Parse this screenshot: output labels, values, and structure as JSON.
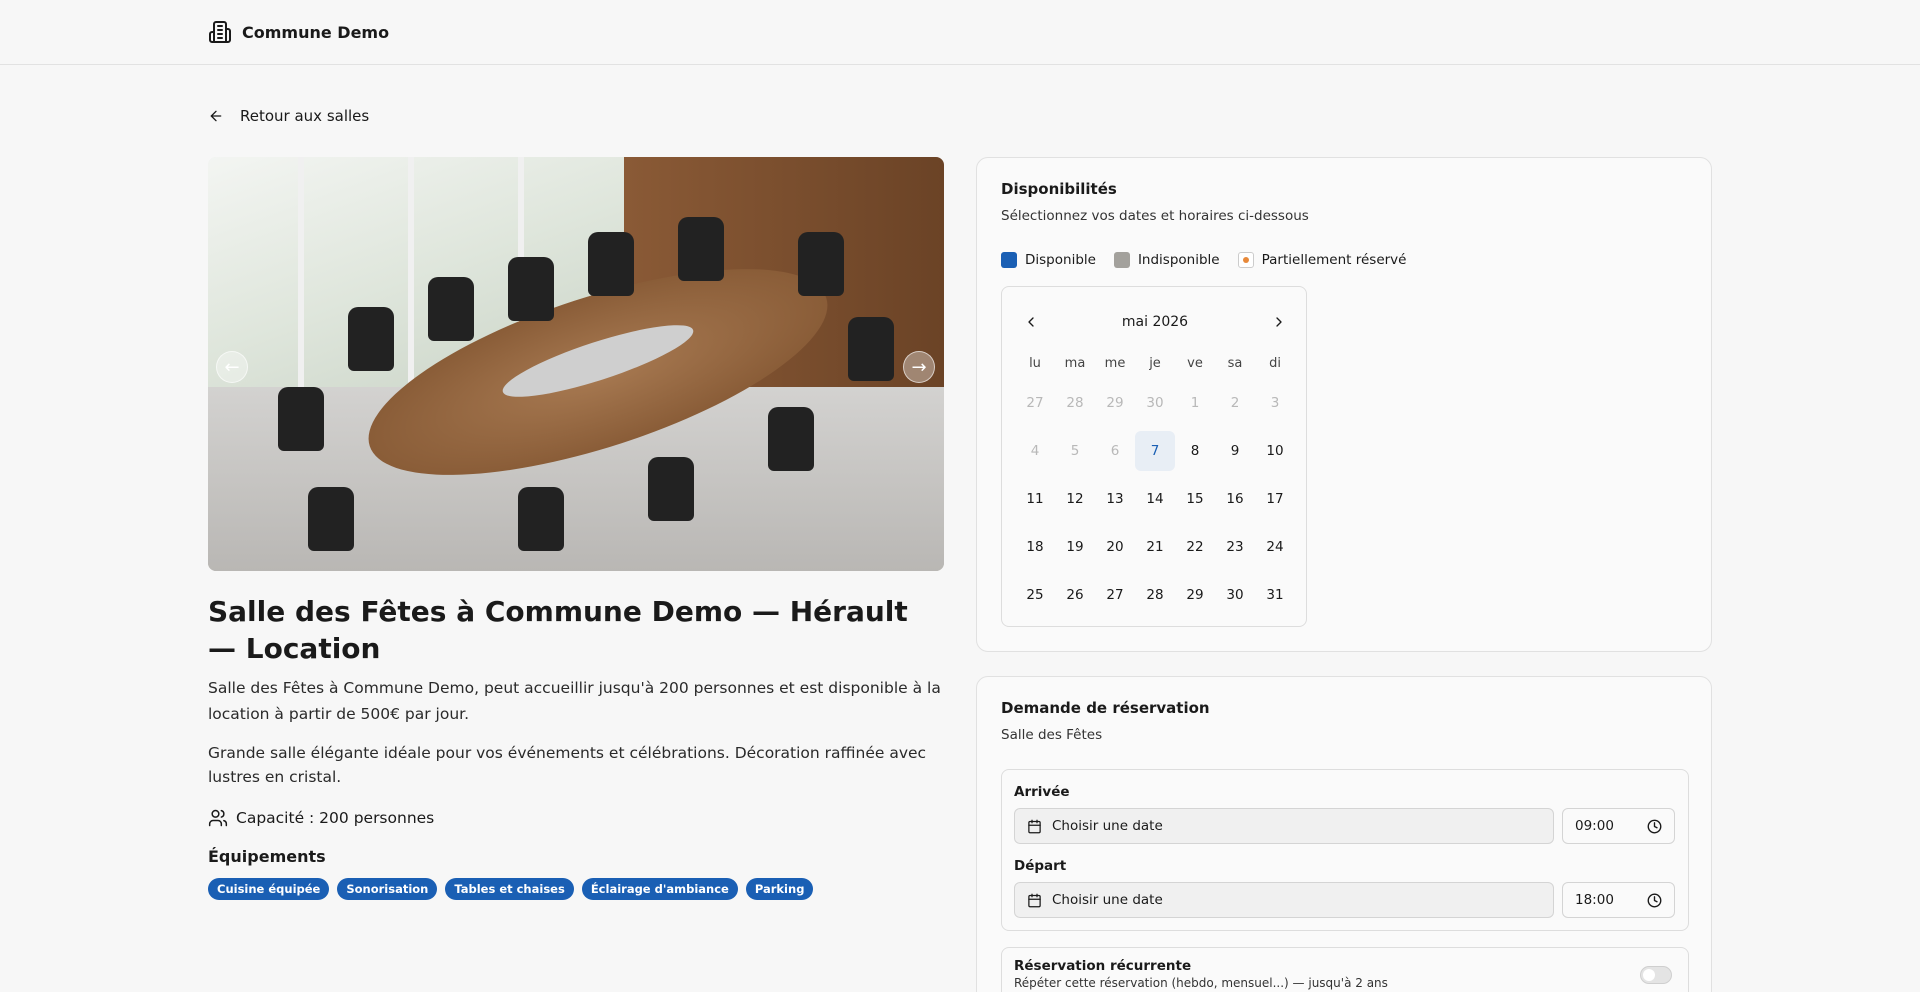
{
  "header": {
    "brand": "Commune Demo"
  },
  "nav": {
    "back_label": "Retour aux salles"
  },
  "room": {
    "title": "Salle des Fêtes à Commune Demo — Hérault — Location",
    "description_1": "Salle des Fêtes à Commune Demo, peut accueillir jusqu'à 200 personnes et est disponible à la location à partir de 500€ par jour.",
    "description_2": "Grande salle élégante idéale pour vos événements et célébrations. Décoration raffinée avec lustres en cristal.",
    "capacity": "Capacité : 200 personnes",
    "equipment_title": "Équipements",
    "equipment": [
      "Cuisine équipée",
      "Sonorisation",
      "Tables et chaises",
      "Éclairage d'ambiance",
      "Parking"
    ]
  },
  "availability": {
    "title": "Disponibilités",
    "subtitle": "Sélectionnez vos dates et horaires ci-dessous",
    "legend": {
      "available": "Disponible",
      "unavailable": "Indisponible",
      "partial": "Partiellement réservé"
    },
    "colors": {
      "available": "#1a5fb4",
      "unavailable": "#a3a19c",
      "partial": "#e8893a"
    },
    "calendar": {
      "month": "mai 2026",
      "weekdays": [
        "lu",
        "ma",
        "me",
        "je",
        "ve",
        "sa",
        "di"
      ],
      "days": [
        {
          "d": "27",
          "state": "muted"
        },
        {
          "d": "28",
          "state": "muted"
        },
        {
          "d": "29",
          "state": "muted"
        },
        {
          "d": "30",
          "state": "muted"
        },
        {
          "d": "1",
          "state": "muted"
        },
        {
          "d": "2",
          "state": "muted"
        },
        {
          "d": "3",
          "state": "muted"
        },
        {
          "d": "4",
          "state": "muted"
        },
        {
          "d": "5",
          "state": "muted"
        },
        {
          "d": "6",
          "state": "muted"
        },
        {
          "d": "7",
          "state": "today"
        },
        {
          "d": "8",
          "state": "normal"
        },
        {
          "d": "9",
          "state": "normal"
        },
        {
          "d": "10",
          "state": "normal"
        },
        {
          "d": "11",
          "state": "normal"
        },
        {
          "d": "12",
          "state": "normal"
        },
        {
          "d": "13",
          "state": "normal"
        },
        {
          "d": "14",
          "state": "normal"
        },
        {
          "d": "15",
          "state": "normal"
        },
        {
          "d": "16",
          "state": "normal"
        },
        {
          "d": "17",
          "state": "normal"
        },
        {
          "d": "18",
          "state": "normal"
        },
        {
          "d": "19",
          "state": "normal"
        },
        {
          "d": "20",
          "state": "normal"
        },
        {
          "d": "21",
          "state": "normal"
        },
        {
          "d": "22",
          "state": "normal"
        },
        {
          "d": "23",
          "state": "normal"
        },
        {
          "d": "24",
          "state": "normal"
        },
        {
          "d": "25",
          "state": "normal"
        },
        {
          "d": "26",
          "state": "normal"
        },
        {
          "d": "27",
          "state": "normal"
        },
        {
          "d": "28",
          "state": "normal"
        },
        {
          "d": "29",
          "state": "normal"
        },
        {
          "d": "30",
          "state": "normal"
        },
        {
          "d": "31",
          "state": "normal"
        }
      ]
    }
  },
  "booking": {
    "title": "Demande de réservation",
    "subtitle": "Salle des Fêtes",
    "arrival_label": "Arrivée",
    "arrival_placeholder": "Choisir une date",
    "arrival_time": "09:00",
    "departure_label": "Départ",
    "departure_placeholder": "Choisir une date",
    "departure_time": "18:00",
    "recurring_title": "Réservation récurrente",
    "recurring_sub": "Répéter cette réservation (hebdo, mensuel...) — jusqu'à 2 ans"
  }
}
